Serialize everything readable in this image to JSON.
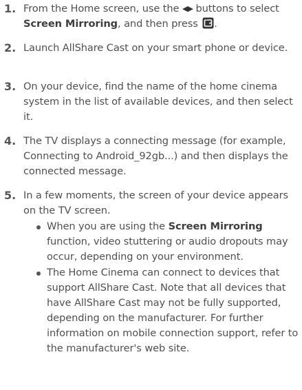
{
  "steps": [
    {
      "number": "1.",
      "text_before": "From the Home screen, use the ",
      "arrow_icons": "◀▶",
      "text_middle": " buttons to select ",
      "bold": "Screen Mirroring",
      "text_after": ", and then press ",
      "end_punctuation": ".",
      "icon": "enter-button-icon"
    },
    {
      "number": "2.",
      "text": "Launch AllShare Cast on your smart phone or device."
    },
    {
      "number": "3.",
      "text": "On your device, find the name of the home cinema system in the list of available devices, and then select it."
    },
    {
      "number": "4.",
      "text": "The TV displays a connecting message (for example, Connecting to Android_92gb...) and then displays the connected message."
    },
    {
      "number": "5.",
      "text": "In a few moments, the screen of your device appears on the TV screen."
    }
  ],
  "bullets": [
    {
      "text_before": "When you are using the ",
      "bold": "Screen Mirroring",
      "text_after": " function, video stuttering or audio dropouts may occur, depending on your environment."
    },
    {
      "text": "The Home Cinema can connect to devices that support AllShare Cast. Note that all devices that have AllShare Cast may not be fully supported, depending on the manufacturer. For further information on mobile connection support, refer to the manufacturer's web site."
    }
  ]
}
